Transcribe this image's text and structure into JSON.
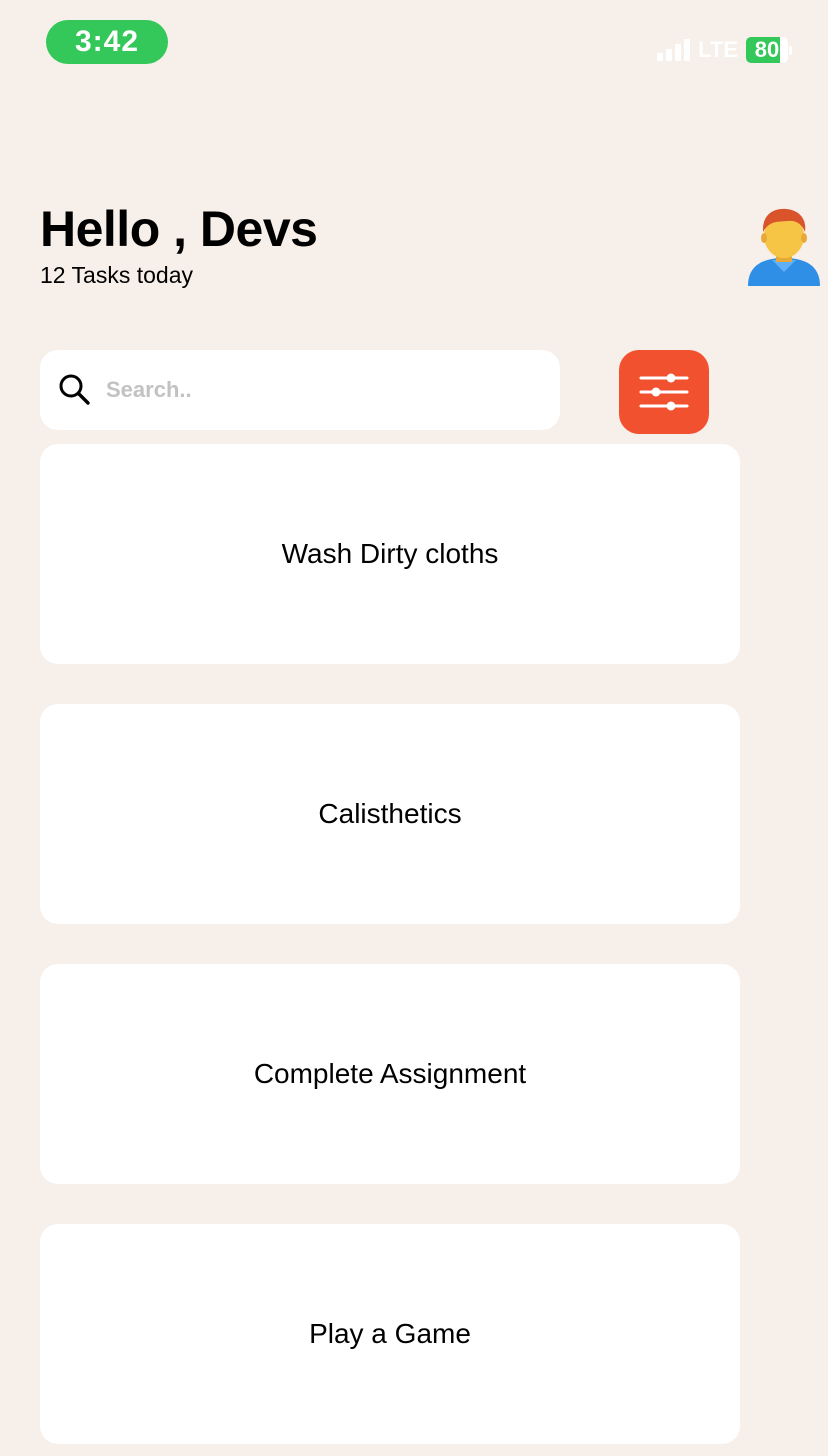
{
  "status_bar": {
    "time": "3:42",
    "network": "LTE",
    "battery": "80",
    "battery_level": 0.8,
    "colors": {
      "time_pill": "#34c759",
      "battery": "#34c759"
    }
  },
  "header": {
    "greeting": "Hello , Devs",
    "subtitle": "12 Tasks today",
    "avatar_icon": "person-avatar-icon"
  },
  "search": {
    "placeholder": "Search..",
    "value": "",
    "icon": "search-icon"
  },
  "filter": {
    "icon": "sliders-icon",
    "color": "#f25130"
  },
  "tasks": [
    {
      "title": "Wash Dirty cloths"
    },
    {
      "title": "Calisthetics"
    },
    {
      "title": "Complete Assignment"
    },
    {
      "title": "Play a Game"
    }
  ],
  "colors": {
    "background": "#f7f0ea",
    "card": "#ffffff"
  }
}
